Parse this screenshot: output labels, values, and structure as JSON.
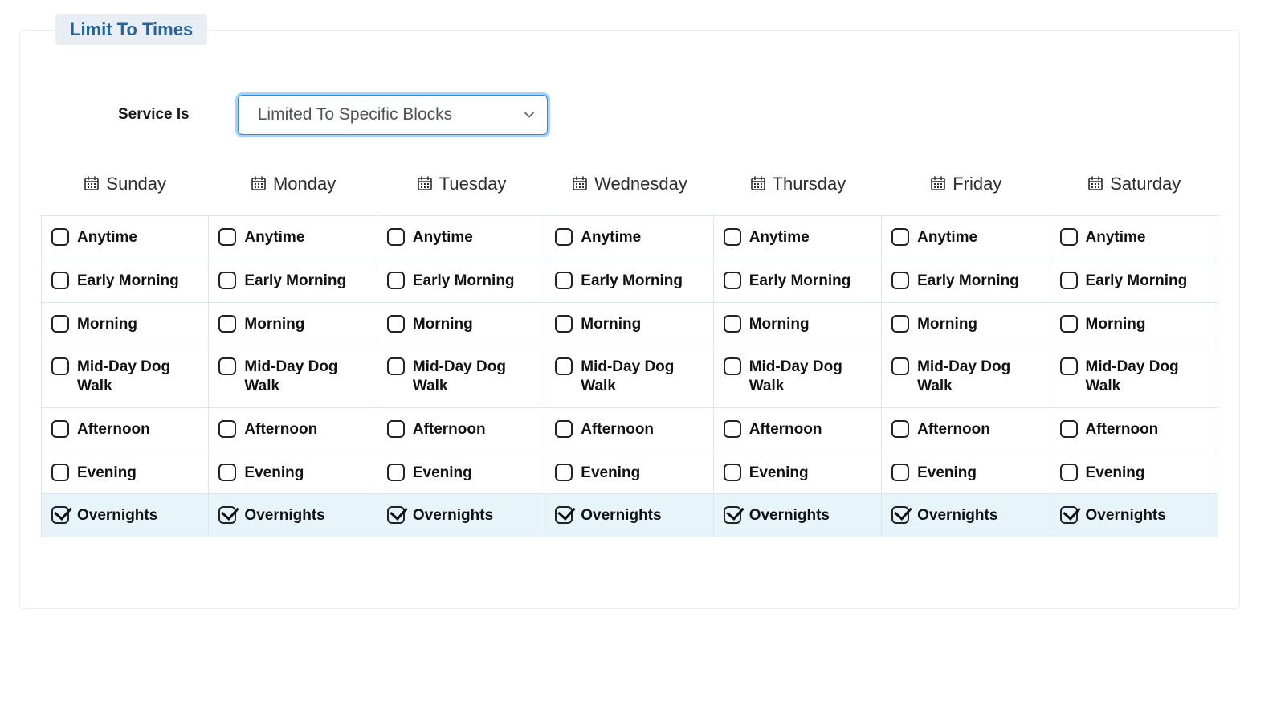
{
  "legend": "Limit To Times",
  "form": {
    "service_label": "Service Is",
    "service_value": "Limited To Specific Blocks"
  },
  "days": [
    "Sunday",
    "Monday",
    "Tuesday",
    "Wednesday",
    "Thursday",
    "Friday",
    "Saturday"
  ],
  "blocks": [
    {
      "label": "Anytime"
    },
    {
      "label": "Early Morning"
    },
    {
      "label": "Morning"
    },
    {
      "label": "Mid-Day Dog Walk"
    },
    {
      "label": "Afternoon"
    },
    {
      "label": "Evening"
    },
    {
      "label": "Overnights"
    }
  ],
  "checked": [
    [
      false,
      false,
      false,
      false,
      false,
      false,
      true
    ],
    [
      false,
      false,
      false,
      false,
      false,
      false,
      true
    ],
    [
      false,
      false,
      false,
      false,
      false,
      false,
      true
    ],
    [
      false,
      false,
      false,
      false,
      false,
      false,
      true
    ],
    [
      false,
      false,
      false,
      false,
      false,
      false,
      true
    ],
    [
      false,
      false,
      false,
      false,
      false,
      false,
      true
    ],
    [
      false,
      false,
      false,
      false,
      false,
      false,
      true
    ]
  ]
}
